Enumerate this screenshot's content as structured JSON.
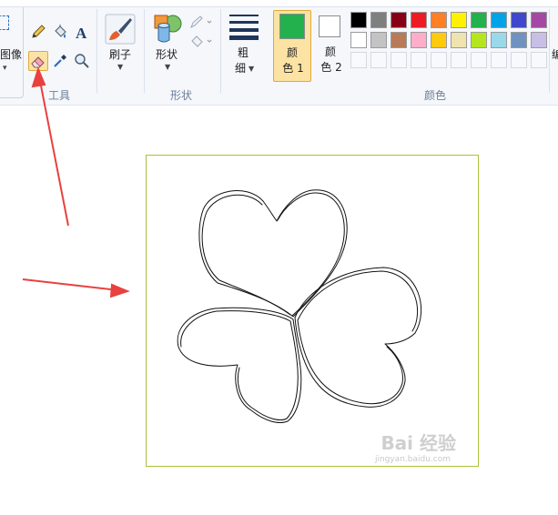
{
  "ribbon": {
    "image_group": {
      "label": "图像"
    },
    "tools_group": {
      "label": "工具"
    },
    "brush": {
      "label": "刷子"
    },
    "shapes_group": {
      "label": "形状",
      "button_label": "形状"
    },
    "size": {
      "label_line1": "粗",
      "label_line2": "细"
    },
    "color1": {
      "label_line1": "颜",
      "label_line2": "色 1",
      "color": "#22b14c"
    },
    "color2": {
      "label_line1": "颜",
      "label_line2": "色 2",
      "color": "#ffffff"
    },
    "colors_group": {
      "label": "颜色"
    },
    "edit_colors": {
      "label": "编"
    }
  },
  "palette": {
    "row1": [
      "#000000",
      "#7f7f7f",
      "#880015",
      "#ed1c24",
      "#ff7f27",
      "#fff200",
      "#22b14c",
      "#00a2e8",
      "#3f48cc",
      "#a349a4"
    ],
    "row2": [
      "#ffffff",
      "#c3c3c3",
      "#b97a57",
      "#ffaec9",
      "#ffc90e",
      "#efe4b0",
      "#b5e61d",
      "#99d9ea",
      "#7092be",
      "#c8bfe7"
    ]
  },
  "canvas": {
    "border_color": "#a8c23a",
    "drawing": "three-leaf clover sketch"
  },
  "annotations": {
    "arrow_color": "#e8413f"
  },
  "watermark": {
    "text": "Bai 经验",
    "sub": "jingyan.baidu.com"
  }
}
